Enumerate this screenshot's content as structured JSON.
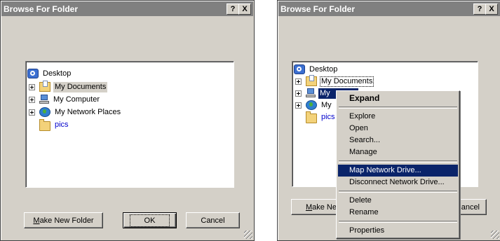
{
  "dialog1": {
    "title": "Browse For Folder",
    "help_glyph": "?",
    "close_glyph": "X",
    "tree": [
      {
        "label": "Desktop",
        "icon": "desktop-icon"
      },
      {
        "label": "My Documents",
        "icon": "folder-documents-icon"
      },
      {
        "label": "My Computer",
        "icon": "computer-icon"
      },
      {
        "label": "My Network Places",
        "icon": "network-places-icon"
      },
      {
        "label": "pics",
        "icon": "folder-icon"
      }
    ],
    "buttons": {
      "make_new_folder_u": "M",
      "make_new_folder_rest": "ake New Folder",
      "ok": "OK",
      "cancel": "Cancel"
    }
  },
  "dialog2": {
    "title": "Browse For Folder",
    "help_glyph": "?",
    "close_glyph": "X",
    "tree": [
      {
        "label": "Desktop"
      },
      {
        "label": "My Documents"
      },
      {
        "label": "My Computer",
        "partial": "My"
      },
      {
        "label": "My Network Places",
        "partial": "My"
      },
      {
        "label": "pics"
      }
    ],
    "buttons": {
      "make_new_u": "M",
      "make_new_rest": "ake New I",
      "cancel_partial": "ancel"
    }
  },
  "context_menu": {
    "items": [
      {
        "label": "Expand",
        "bold": true
      },
      {
        "separator": true
      },
      {
        "label": "Explore"
      },
      {
        "label": "Open"
      },
      {
        "label": "Search..."
      },
      {
        "label": "Manage"
      },
      {
        "separator": true
      },
      {
        "label": "Map Network Drive...",
        "highlighted": true
      },
      {
        "label": "Disconnect Network Drive..."
      },
      {
        "separator": true
      },
      {
        "label": "Delete"
      },
      {
        "label": "Rename"
      },
      {
        "separator": true
      },
      {
        "label": "Properties"
      }
    ]
  },
  "colors": {
    "dialog_face": "#d4d0c8",
    "title_inactive": "#808080",
    "selection": "#0a246a",
    "link_blue": "#0000cc"
  }
}
